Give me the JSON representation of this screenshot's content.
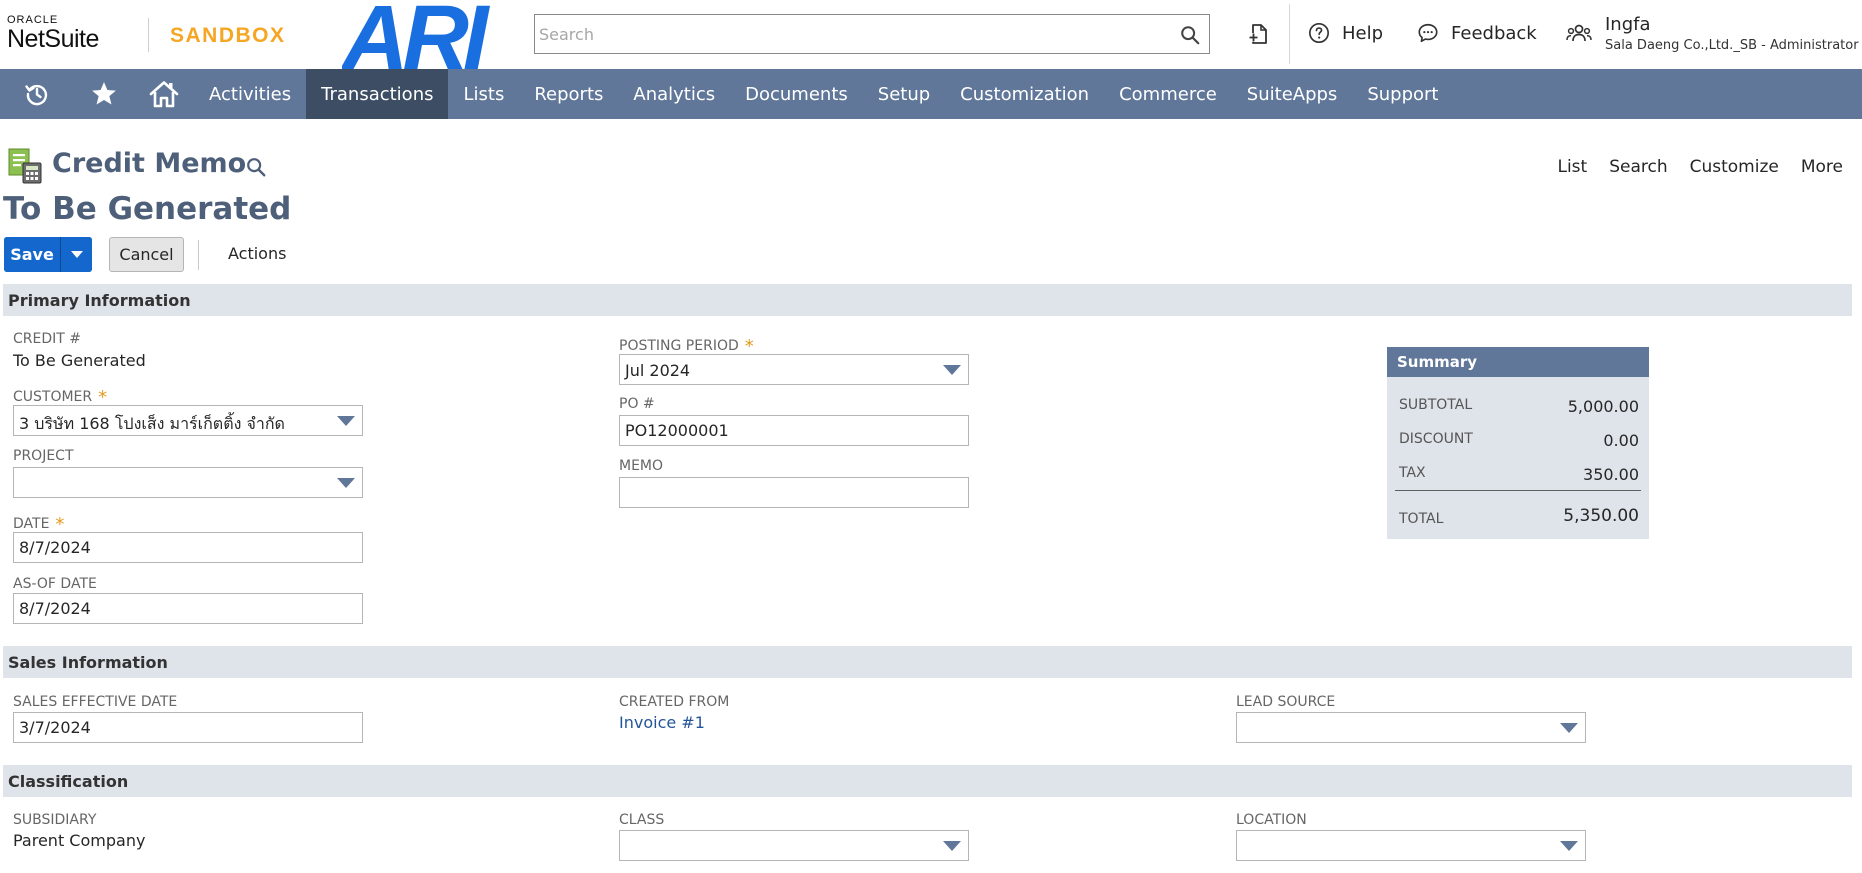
{
  "header": {
    "brand_top": "ORACLE",
    "brand_name": "NetSuite",
    "environment": "SANDBOX",
    "company_logo_text": "ARI",
    "search_placeholder": "Search",
    "help_label": "Help",
    "feedback_label": "Feedback",
    "user_name": "Ingfa",
    "user_role": "Sala Daeng Co.,Ltd._SB - Administrator"
  },
  "nav": {
    "items": [
      {
        "label": "Activities",
        "active": false
      },
      {
        "label": "Transactions",
        "active": true
      },
      {
        "label": "Lists",
        "active": false
      },
      {
        "label": "Reports",
        "active": false
      },
      {
        "label": "Analytics",
        "active": false
      },
      {
        "label": "Documents",
        "active": false
      },
      {
        "label": "Setup",
        "active": false
      },
      {
        "label": "Customization",
        "active": false
      },
      {
        "label": "Commerce",
        "active": false
      },
      {
        "label": "SuiteApps",
        "active": false
      },
      {
        "label": "Support",
        "active": false
      }
    ]
  },
  "page": {
    "title": "Credit Memo",
    "subtitle": "To Be Generated",
    "links": [
      "List",
      "Search",
      "Customize",
      "More"
    ]
  },
  "buttons": {
    "save": "Save",
    "cancel": "Cancel",
    "actions": "Actions"
  },
  "primary": {
    "section_title": "Primary Information",
    "credit_label": "CREDIT #",
    "credit_value": "To Be Generated",
    "customer_label": "CUSTOMER",
    "customer_value": "3 บริษัท 168 โปงเส็ง มาร์เก็ตติ้ง จำกัด",
    "project_label": "PROJECT",
    "project_value": "",
    "date_label": "DATE",
    "date_value": "8/7/2024",
    "asof_label": "AS-OF DATE",
    "asof_value": "8/7/2024",
    "posting_label": "POSTING PERIOD",
    "posting_value": "Jul 2024",
    "po_label": "PO #",
    "po_value": "PO12000001",
    "memo_label": "MEMO",
    "memo_value": ""
  },
  "summary": {
    "title": "Summary",
    "subtotal_label": "SUBTOTAL",
    "subtotal_value": "5,000.00",
    "discount_label": "DISCOUNT",
    "discount_value": "0.00",
    "tax_label": "TAX",
    "tax_value": "350.00",
    "total_label": "TOTAL",
    "total_value": "5,350.00"
  },
  "sales": {
    "section_title": "Sales Information",
    "effective_label": "SALES EFFECTIVE DATE",
    "effective_value": "3/7/2024",
    "created_label": "CREATED FROM",
    "created_value": "Invoice #1",
    "lead_label": "LEAD SOURCE",
    "lead_value": ""
  },
  "classification": {
    "section_title": "Classification",
    "subsidiary_label": "SUBSIDIARY",
    "subsidiary_value": "Parent Company",
    "class_label": "CLASS",
    "class_value": "",
    "location_label": "LOCATION",
    "location_value": ""
  },
  "colors": {
    "nav_bg": "#607799",
    "nav_active": "#3d4d63",
    "title": "#4d5f79",
    "save_button": "#1467cc",
    "section_bg": "#dfe4eb",
    "required": "#e39a23",
    "sandbox": "#f5a623",
    "ari_logo": "#1a6fe0"
  },
  "icons": {
    "search": "search-icon",
    "recent": "recent-records-icon",
    "help": "help-circle-icon",
    "feedback": "chat-bubble-icon",
    "user": "user-group-icon",
    "history": "history-icon",
    "favorites": "star-icon",
    "home": "home-icon",
    "record": "credit-memo-record-icon"
  }
}
